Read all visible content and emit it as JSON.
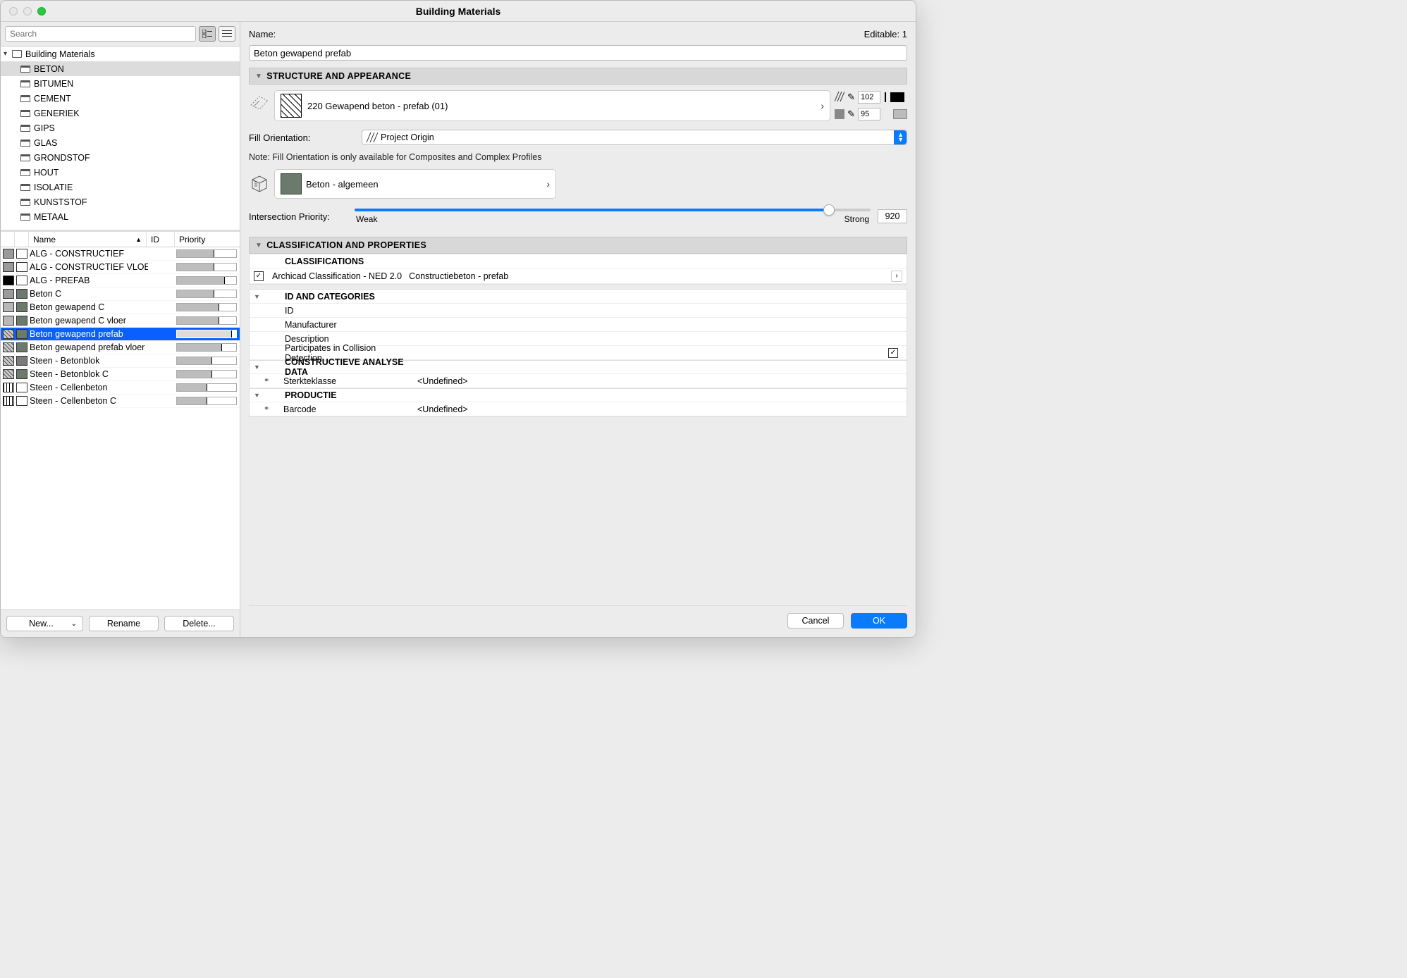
{
  "window": {
    "title": "Building Materials"
  },
  "search": {
    "placeholder": "Search"
  },
  "tree": {
    "root": "Building Materials",
    "folders": [
      "BETON",
      "BITUMEN",
      "CEMENT",
      "GENERIEK",
      "GIPS",
      "GLAS",
      "GRONDSTOF",
      "HOUT",
      "ISOLATIE",
      "KUNSTSTOF",
      "METAAL"
    ],
    "selectedIndex": 0
  },
  "table": {
    "columns": {
      "name": "Name",
      "id": "ID",
      "priority": "Priority"
    },
    "rows": [
      {
        "name": "ALG - CONSTRUCTIEF",
        "sw1": "#9a9a9a",
        "sw2": "#ffffff",
        "pfill": 62,
        "pmark": 62
      },
      {
        "name": "ALG - CONSTRUCTIEF VLOER",
        "sw1": "#9a9a9a",
        "sw2": "#ffffff",
        "pfill": 62,
        "pmark": 62
      },
      {
        "name": "ALG - PREFAB",
        "sw1": "#000000",
        "sw2": "#ffffff",
        "pfill": 80,
        "pmark": 80
      },
      {
        "name": "Beton C",
        "sw1": "#9a9a9a",
        "sw2": "#6b7a6c",
        "pfill": 62,
        "pmark": 62
      },
      {
        "name": "Beton gewapend C",
        "sw1": "#b8b8b8",
        "sw2": "#6b7a6c",
        "pfill": 70,
        "pmark": 70
      },
      {
        "name": "Beton gewapend C vloer",
        "sw1": "#b8b8b8",
        "sw2": "#6b7a6c",
        "pfill": 70,
        "pmark": 70
      },
      {
        "name": "Beton gewapend prefab",
        "sw1": "hatch",
        "sw2": "#6b7a6c",
        "pfill": 92,
        "pmark": 92,
        "selected": true
      },
      {
        "name": "Beton gewapend prefab vloer",
        "sw1": "hatch",
        "sw2": "#6b7a6c",
        "pfill": 75,
        "pmark": 75
      },
      {
        "name": "Steen - Betonblok",
        "sw1": "cross",
        "sw2": "#7a7a7a",
        "pfill": 58,
        "pmark": 58
      },
      {
        "name": "Steen - Betonblok C",
        "sw1": "cross",
        "sw2": "#6b7a6c",
        "pfill": 58,
        "pmark": 58
      },
      {
        "name": "Steen - Cellenbeton",
        "sw1": "stripe",
        "sw2": "#ffffff",
        "pfill": 50,
        "pmark": 50
      },
      {
        "name": "Steen - Cellenbeton C",
        "sw1": "stripe",
        "sw2": "#ffffff",
        "pfill": 50,
        "pmark": 50
      }
    ]
  },
  "leftFooter": {
    "new": "New...",
    "rename": "Rename",
    "delete": "Delete..."
  },
  "detail": {
    "nameLabel": "Name:",
    "editableLabel": "Editable: 1",
    "nameValue": "Beton gewapend prefab",
    "sections": {
      "structure": "STRUCTURE AND APPEARANCE",
      "classification": "CLASSIFICATION AND PROPERTIES"
    },
    "fillName": "220 Gewapend beton - prefab (01)",
    "pen1": "102",
    "pen2": "95",
    "fillOrientationLabel": "Fill Orientation:",
    "fillOrientationValue": "Project Origin",
    "note": "Note: Fill Orientation is only available for Composites and Complex Profiles",
    "surfaceName": "Beton - algemeen",
    "surfaceColor": "#6b7a6c",
    "priorityLabel": "Intersection Priority:",
    "priorityWeak": "Weak",
    "priorityStrong": "Strong",
    "priorityValue": "920",
    "priorityPercent": 92,
    "classifications": {
      "header": "CLASSIFICATIONS",
      "item": "Archicad Classification - NED 2.0",
      "value": "Constructiebeton - prefab"
    },
    "idCategories": {
      "header": "ID AND CATEGORIES",
      "rows": [
        "ID",
        "Manufacturer",
        "Description",
        "Participates in Collision Detection"
      ]
    },
    "constructieve": {
      "header": "CONSTRUCTIEVE ANALYSE DATA",
      "row": "Sterkteklasse",
      "value": "<Undefined>"
    },
    "productie": {
      "header": "PRODUCTIE",
      "row": "Barcode",
      "value": "<Undefined>"
    }
  },
  "footer": {
    "cancel": "Cancel",
    "ok": "OK"
  }
}
